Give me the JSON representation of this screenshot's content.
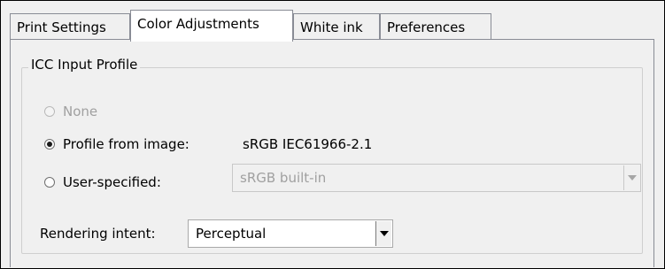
{
  "tabs": [
    {
      "label": "Print Settings",
      "active": false
    },
    {
      "label": "Color Adjustments",
      "active": true
    },
    {
      "label": "White ink",
      "active": false
    },
    {
      "label": "Preferences",
      "active": false
    }
  ],
  "icc": {
    "group_title": "ICC Input Profile",
    "options": {
      "none": {
        "label": "None",
        "enabled": false,
        "checked": false
      },
      "from_image": {
        "label": "Profile from image:",
        "value": "sRGB IEC61966-2.1",
        "checked": true
      },
      "user_specified": {
        "label": "User-specified:",
        "checked": false,
        "select_value": "sRGB built-in",
        "select_enabled": false
      }
    }
  },
  "rendering_intent": {
    "label": "Rendering intent:",
    "value": "Perceptual"
  },
  "icons": {
    "dropdown": "chevron-down-icon"
  }
}
